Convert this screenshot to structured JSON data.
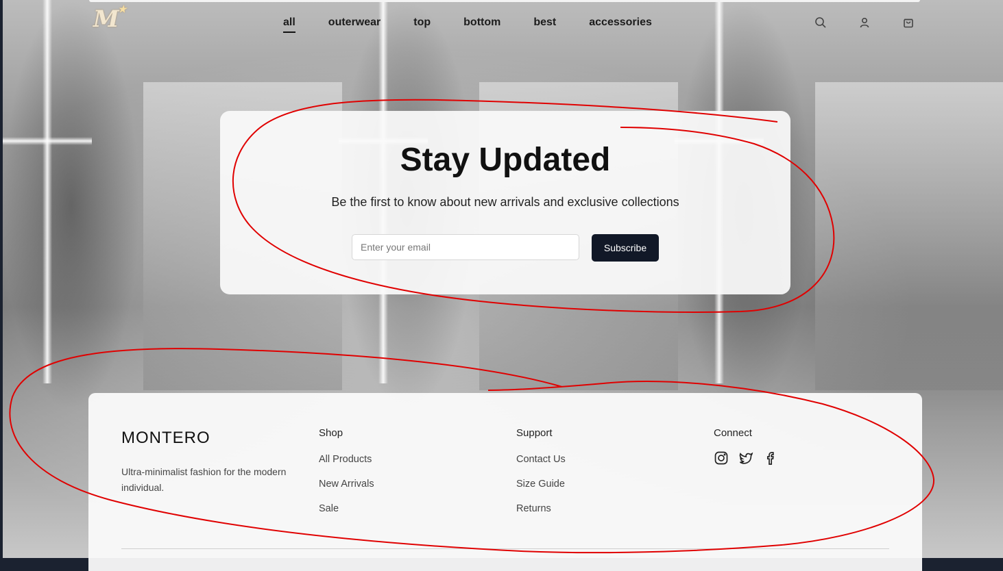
{
  "header": {
    "logo_text": "M",
    "logo_star": "★",
    "nav": [
      {
        "label": "all",
        "active": true
      },
      {
        "label": "outerwear"
      },
      {
        "label": "top"
      },
      {
        "label": "bottom"
      },
      {
        "label": "best"
      },
      {
        "label": "accessories"
      }
    ],
    "icons": [
      "search-icon",
      "user-icon",
      "cart-icon"
    ]
  },
  "newsletter": {
    "title": "Stay Updated",
    "subtitle": "Be the first to know about new arrivals and exclusive collections",
    "email_placeholder": "Enter your email",
    "button_label": "Subscribe"
  },
  "footer": {
    "brand": "MONTERO",
    "tagline": "Ultra-minimalist fashion for the modern individual.",
    "columns": [
      {
        "heading": "Shop",
        "links": [
          "All Products",
          "New Arrivals",
          "Sale"
        ]
      },
      {
        "heading": "Support",
        "links": [
          "Contact Us",
          "Size Guide",
          "Returns"
        ]
      },
      {
        "heading": "Connect",
        "links": []
      }
    ],
    "social_icons": [
      "instagram-icon",
      "twitter-icon",
      "facebook-icon"
    ]
  },
  "colors": {
    "subscribe_button": "#111827",
    "annotation": "#e00000"
  }
}
